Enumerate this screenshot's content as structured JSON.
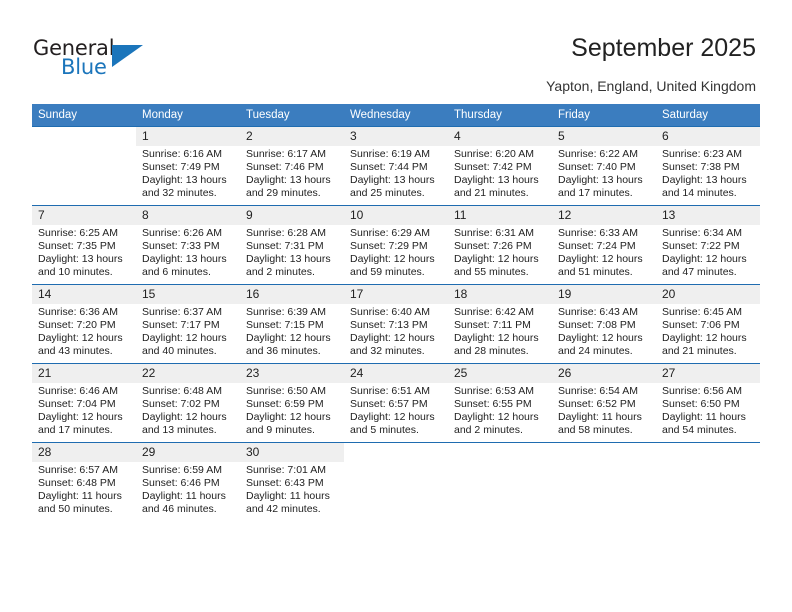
{
  "brand": {
    "name_part1": "General",
    "name_part2": "Blue",
    "logo_icon": "triangle-logo-icon",
    "accent_color": "#1b75bb"
  },
  "header": {
    "title": "September 2025",
    "location": "Yapton, England, United Kingdom"
  },
  "calendar": {
    "header_bg": "#3b7dbf",
    "row_divider_color": "#1f6cb0",
    "daynum_band_bg": "#efefef",
    "weekday_headers": [
      "Sunday",
      "Monday",
      "Tuesday",
      "Wednesday",
      "Thursday",
      "Friday",
      "Saturday"
    ],
    "weeks": [
      [
        {
          "day": "",
          "sunrise": "",
          "sunset": "",
          "daylight_line1": "",
          "daylight_line2": ""
        },
        {
          "day": "1",
          "sunrise": "Sunrise: 6:16 AM",
          "sunset": "Sunset: 7:49 PM",
          "daylight_line1": "Daylight: 13 hours",
          "daylight_line2": "and 32 minutes."
        },
        {
          "day": "2",
          "sunrise": "Sunrise: 6:17 AM",
          "sunset": "Sunset: 7:46 PM",
          "daylight_line1": "Daylight: 13 hours",
          "daylight_line2": "and 29 minutes."
        },
        {
          "day": "3",
          "sunrise": "Sunrise: 6:19 AM",
          "sunset": "Sunset: 7:44 PM",
          "daylight_line1": "Daylight: 13 hours",
          "daylight_line2": "and 25 minutes."
        },
        {
          "day": "4",
          "sunrise": "Sunrise: 6:20 AM",
          "sunset": "Sunset: 7:42 PM",
          "daylight_line1": "Daylight: 13 hours",
          "daylight_line2": "and 21 minutes."
        },
        {
          "day": "5",
          "sunrise": "Sunrise: 6:22 AM",
          "sunset": "Sunset: 7:40 PM",
          "daylight_line1": "Daylight: 13 hours",
          "daylight_line2": "and 17 minutes."
        },
        {
          "day": "6",
          "sunrise": "Sunrise: 6:23 AM",
          "sunset": "Sunset: 7:38 PM",
          "daylight_line1": "Daylight: 13 hours",
          "daylight_line2": "and 14 minutes."
        }
      ],
      [
        {
          "day": "7",
          "sunrise": "Sunrise: 6:25 AM",
          "sunset": "Sunset: 7:35 PM",
          "daylight_line1": "Daylight: 13 hours",
          "daylight_line2": "and 10 minutes."
        },
        {
          "day": "8",
          "sunrise": "Sunrise: 6:26 AM",
          "sunset": "Sunset: 7:33 PM",
          "daylight_line1": "Daylight: 13 hours",
          "daylight_line2": "and 6 minutes."
        },
        {
          "day": "9",
          "sunrise": "Sunrise: 6:28 AM",
          "sunset": "Sunset: 7:31 PM",
          "daylight_line1": "Daylight: 13 hours",
          "daylight_line2": "and 2 minutes."
        },
        {
          "day": "10",
          "sunrise": "Sunrise: 6:29 AM",
          "sunset": "Sunset: 7:29 PM",
          "daylight_line1": "Daylight: 12 hours",
          "daylight_line2": "and 59 minutes."
        },
        {
          "day": "11",
          "sunrise": "Sunrise: 6:31 AM",
          "sunset": "Sunset: 7:26 PM",
          "daylight_line1": "Daylight: 12 hours",
          "daylight_line2": "and 55 minutes."
        },
        {
          "day": "12",
          "sunrise": "Sunrise: 6:33 AM",
          "sunset": "Sunset: 7:24 PM",
          "daylight_line1": "Daylight: 12 hours",
          "daylight_line2": "and 51 minutes."
        },
        {
          "day": "13",
          "sunrise": "Sunrise: 6:34 AM",
          "sunset": "Sunset: 7:22 PM",
          "daylight_line1": "Daylight: 12 hours",
          "daylight_line2": "and 47 minutes."
        }
      ],
      [
        {
          "day": "14",
          "sunrise": "Sunrise: 6:36 AM",
          "sunset": "Sunset: 7:20 PM",
          "daylight_line1": "Daylight: 12 hours",
          "daylight_line2": "and 43 minutes."
        },
        {
          "day": "15",
          "sunrise": "Sunrise: 6:37 AM",
          "sunset": "Sunset: 7:17 PM",
          "daylight_line1": "Daylight: 12 hours",
          "daylight_line2": "and 40 minutes."
        },
        {
          "day": "16",
          "sunrise": "Sunrise: 6:39 AM",
          "sunset": "Sunset: 7:15 PM",
          "daylight_line1": "Daylight: 12 hours",
          "daylight_line2": "and 36 minutes."
        },
        {
          "day": "17",
          "sunrise": "Sunrise: 6:40 AM",
          "sunset": "Sunset: 7:13 PM",
          "daylight_line1": "Daylight: 12 hours",
          "daylight_line2": "and 32 minutes."
        },
        {
          "day": "18",
          "sunrise": "Sunrise: 6:42 AM",
          "sunset": "Sunset: 7:11 PM",
          "daylight_line1": "Daylight: 12 hours",
          "daylight_line2": "and 28 minutes."
        },
        {
          "day": "19",
          "sunrise": "Sunrise: 6:43 AM",
          "sunset": "Sunset: 7:08 PM",
          "daylight_line1": "Daylight: 12 hours",
          "daylight_line2": "and 24 minutes."
        },
        {
          "day": "20",
          "sunrise": "Sunrise: 6:45 AM",
          "sunset": "Sunset: 7:06 PM",
          "daylight_line1": "Daylight: 12 hours",
          "daylight_line2": "and 21 minutes."
        }
      ],
      [
        {
          "day": "21",
          "sunrise": "Sunrise: 6:46 AM",
          "sunset": "Sunset: 7:04 PM",
          "daylight_line1": "Daylight: 12 hours",
          "daylight_line2": "and 17 minutes."
        },
        {
          "day": "22",
          "sunrise": "Sunrise: 6:48 AM",
          "sunset": "Sunset: 7:02 PM",
          "daylight_line1": "Daylight: 12 hours",
          "daylight_line2": "and 13 minutes."
        },
        {
          "day": "23",
          "sunrise": "Sunrise: 6:50 AM",
          "sunset": "Sunset: 6:59 PM",
          "daylight_line1": "Daylight: 12 hours",
          "daylight_line2": "and 9 minutes."
        },
        {
          "day": "24",
          "sunrise": "Sunrise: 6:51 AM",
          "sunset": "Sunset: 6:57 PM",
          "daylight_line1": "Daylight: 12 hours",
          "daylight_line2": "and 5 minutes."
        },
        {
          "day": "25",
          "sunrise": "Sunrise: 6:53 AM",
          "sunset": "Sunset: 6:55 PM",
          "daylight_line1": "Daylight: 12 hours",
          "daylight_line2": "and 2 minutes."
        },
        {
          "day": "26",
          "sunrise": "Sunrise: 6:54 AM",
          "sunset": "Sunset: 6:52 PM",
          "daylight_line1": "Daylight: 11 hours",
          "daylight_line2": "and 58 minutes."
        },
        {
          "day": "27",
          "sunrise": "Sunrise: 6:56 AM",
          "sunset": "Sunset: 6:50 PM",
          "daylight_line1": "Daylight: 11 hours",
          "daylight_line2": "and 54 minutes."
        }
      ],
      [
        {
          "day": "28",
          "sunrise": "Sunrise: 6:57 AM",
          "sunset": "Sunset: 6:48 PM",
          "daylight_line1": "Daylight: 11 hours",
          "daylight_line2": "and 50 minutes."
        },
        {
          "day": "29",
          "sunrise": "Sunrise: 6:59 AM",
          "sunset": "Sunset: 6:46 PM",
          "daylight_line1": "Daylight: 11 hours",
          "daylight_line2": "and 46 minutes."
        },
        {
          "day": "30",
          "sunrise": "Sunrise: 7:01 AM",
          "sunset": "Sunset: 6:43 PM",
          "daylight_line1": "Daylight: 11 hours",
          "daylight_line2": "and 42 minutes."
        },
        {
          "day": "",
          "sunrise": "",
          "sunset": "",
          "daylight_line1": "",
          "daylight_line2": ""
        },
        {
          "day": "",
          "sunrise": "",
          "sunset": "",
          "daylight_line1": "",
          "daylight_line2": ""
        },
        {
          "day": "",
          "sunrise": "",
          "sunset": "",
          "daylight_line1": "",
          "daylight_line2": ""
        },
        {
          "day": "",
          "sunrise": "",
          "sunset": "",
          "daylight_line1": "",
          "daylight_line2": ""
        }
      ]
    ]
  }
}
